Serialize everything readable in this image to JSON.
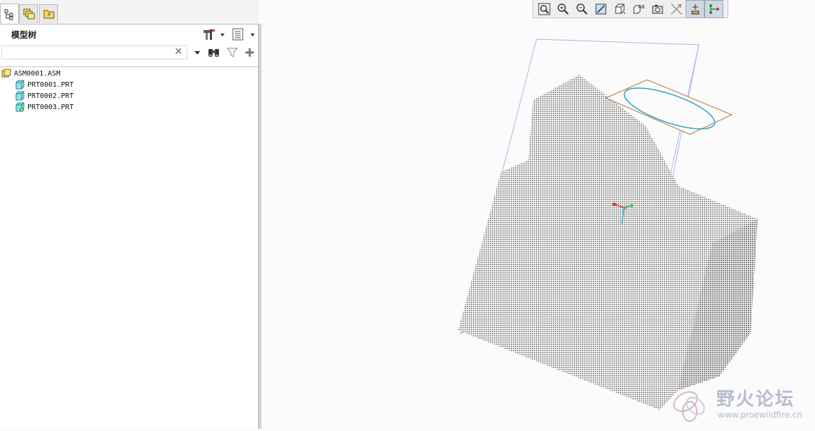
{
  "tabs": [
    {
      "icon": "model-tree-icon"
    },
    {
      "icon": "layers-icon"
    },
    {
      "icon": "favorites-folder-icon"
    }
  ],
  "panel": {
    "title": "模型树",
    "search": {
      "value": "",
      "placeholder": "",
      "clear_glyph": "✕"
    }
  },
  "tree": {
    "root": "ASM0001.ASM",
    "children": [
      "PRT0001.PRT",
      "PRT0002.PRT",
      "PRT0003.PRT"
    ]
  },
  "toolbar": {
    "tools": [
      "refit-icon",
      "zoom-in-icon",
      "zoom-out-icon",
      "repaint-icon",
      "display-style-icon",
      "saved-views-icon",
      "view-manager-icon",
      "datum-display-icon",
      "spin-center-icon",
      "annotation-display-icon"
    ]
  },
  "watermark": {
    "title": "野火论坛",
    "url": "www.proewildfire.cn"
  },
  "colors": {
    "model_fill": "#9a9a9a",
    "datum_plane": "#aab2ec",
    "sketch_plane": "#b47038",
    "ellipse": "#29a6c6",
    "accent": "#2c6fb3"
  }
}
